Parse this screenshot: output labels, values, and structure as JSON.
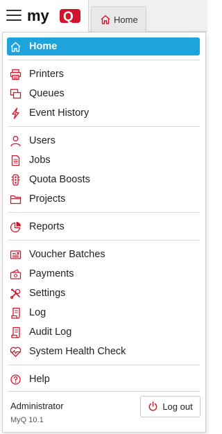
{
  "brand": {
    "logo_text": "myQ",
    "accent": "#d4142b"
  },
  "tab": {
    "label": "Home"
  },
  "menu": {
    "active_color": "#1ea4dc",
    "items": [
      {
        "label": "Home",
        "icon": "home-icon"
      },
      {
        "label": "Printers",
        "icon": "printer-icon"
      },
      {
        "label": "Queues",
        "icon": "queues-icon"
      },
      {
        "label": "Event History",
        "icon": "lightning-icon"
      },
      {
        "label": "Users",
        "icon": "user-icon"
      },
      {
        "label": "Jobs",
        "icon": "document-icon"
      },
      {
        "label": "Quota Boosts",
        "icon": "traffic-light-icon"
      },
      {
        "label": "Projects",
        "icon": "folder-icon"
      },
      {
        "label": "Reports",
        "icon": "pie-chart-icon"
      },
      {
        "label": "Voucher Batches",
        "icon": "voucher-icon"
      },
      {
        "label": "Payments",
        "icon": "payment-icon"
      },
      {
        "label": "Settings",
        "icon": "tools-icon"
      },
      {
        "label": "Log",
        "icon": "log-icon"
      },
      {
        "label": "Audit Log",
        "icon": "audit-log-icon"
      },
      {
        "label": "System Health Check",
        "icon": "heartbeat-icon"
      },
      {
        "label": "Help",
        "icon": "help-icon"
      }
    ]
  },
  "footer": {
    "user": "Administrator",
    "version": "MyQ 10.1",
    "logout_label": "Log out"
  }
}
